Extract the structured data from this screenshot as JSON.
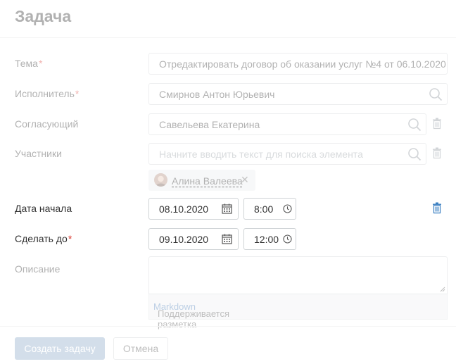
{
  "dialog": {
    "title": "Задача"
  },
  "fields": {
    "subject": {
      "label": "Тема",
      "required": "*",
      "value": "Отредактировать договор об оказании услуг №4 от 06.10.2020"
    },
    "assignee": {
      "label": "Исполнитель",
      "required": "*",
      "value": "Смирнов Антон Юрьевич"
    },
    "approver": {
      "label": "Согласующий",
      "value": "Савельева Екатерина"
    },
    "participants": {
      "label": "Участники",
      "placeholder": "Начните вводить текст для поиска элемента",
      "chip": "Алина Валеева",
      "chip_remove": "✕"
    },
    "start": {
      "label": "Дата начала",
      "date": "08.10.2020",
      "time": "8:00"
    },
    "due": {
      "label": "Сделать до",
      "required": "*",
      "date": "09.10.2020",
      "time": "12:00"
    },
    "description": {
      "label": "Описание",
      "hint_prefix": "Поддерживается разметка",
      "hint_link": "Markdown"
    }
  },
  "footer": {
    "create_label": "Создать задачу",
    "cancel_label": "Отмена"
  },
  "colors": {
    "primary_button": "#8ba9c9",
    "required": "#d9342b",
    "link": "#4d7fb8",
    "trash_active": "#3a7fc1"
  }
}
